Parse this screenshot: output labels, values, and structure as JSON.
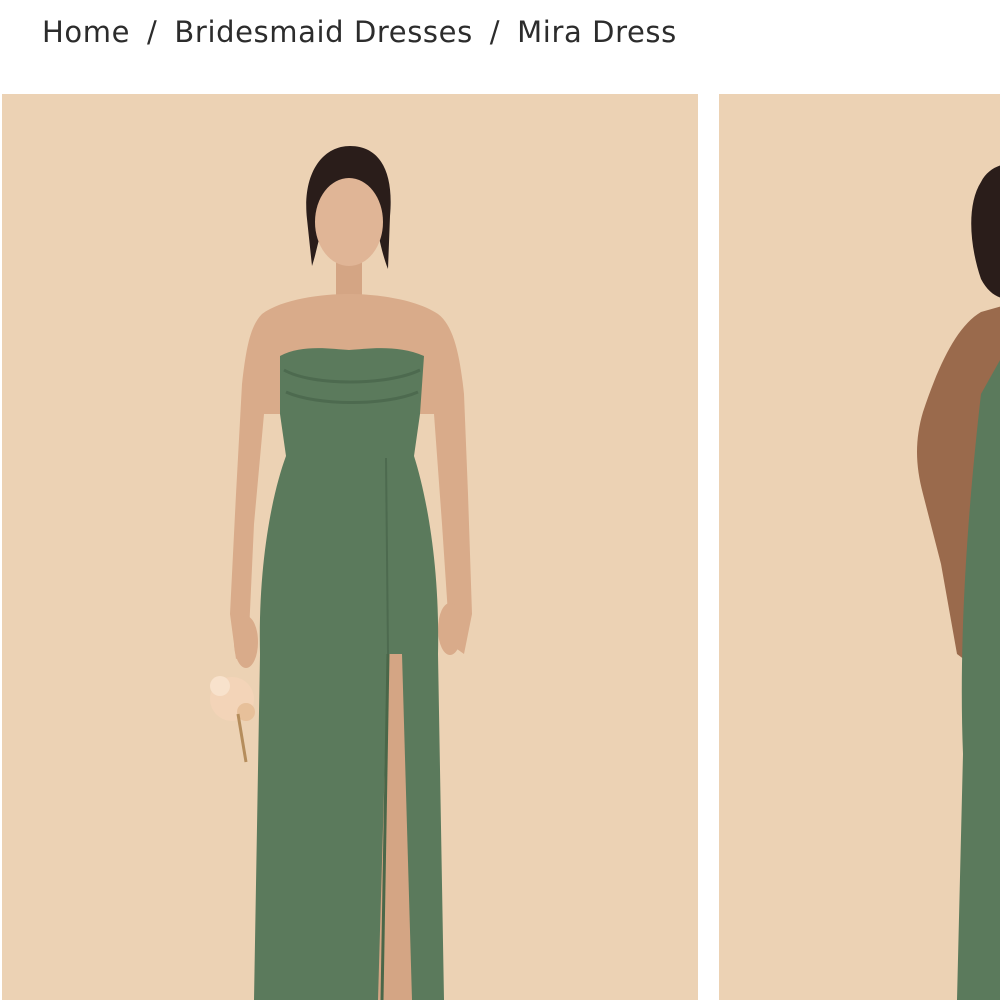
{
  "breadcrumb": {
    "items": [
      {
        "label": "Home"
      },
      {
        "label": "Bridesmaid Dresses"
      }
    ],
    "separator": "/",
    "current": "Mira Dress"
  },
  "gallery": {
    "images": [
      {
        "subject": "model-front-view",
        "dress_color": "#5b7a5c",
        "background": "#ecd2b4"
      },
      {
        "subject": "model-partial-side-view",
        "dress_color": "#5b7a5c",
        "background": "#ecd2b4"
      }
    ]
  },
  "colors": {
    "text": "#2c2c2c",
    "photo_background": "#ecd2b4",
    "dress_green": "#5b7a5c",
    "skin": "#d9ab8a"
  }
}
